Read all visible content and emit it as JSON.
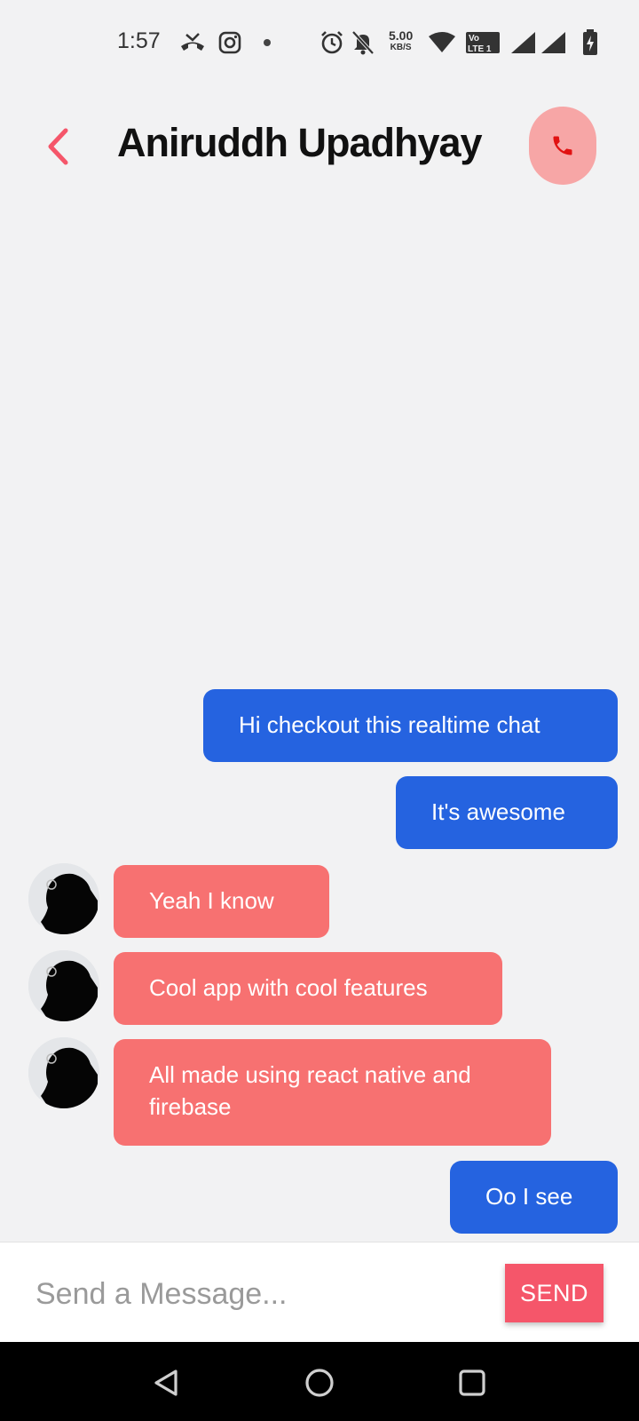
{
  "status_bar": {
    "time": "1:57",
    "speed_value": "5.00",
    "speed_unit": "KB/S",
    "icons": [
      "missed-call-icon",
      "instagram-icon",
      "dot-icon",
      "alarm-icon",
      "bell-off-icon",
      "wifi-icon",
      "volte-icon",
      "signal-icon",
      "signal-icon",
      "battery-charging-icon"
    ],
    "volte_label": "LTE 1"
  },
  "header": {
    "contact_name": "Aniruddh Upadhyay",
    "back_icon": "chevron-left-icon",
    "call_icon": "phone-icon"
  },
  "messages": [
    {
      "type": "sent",
      "text": "Hi checkout this realtime chat"
    },
    {
      "type": "sent",
      "text": "It's awesome"
    },
    {
      "type": "received",
      "text": "Yeah I know"
    },
    {
      "type": "received",
      "text": "Cool app with cool features"
    },
    {
      "type": "received",
      "text": "All made using react native and firebase"
    },
    {
      "type": "sent",
      "text": "Oo I see"
    }
  ],
  "composer": {
    "placeholder": "Send a Message...",
    "value": "",
    "send_label": "SEND"
  },
  "nav_bar": {
    "icons": [
      "back-triangle-icon",
      "home-circle-icon",
      "recents-square-icon"
    ]
  },
  "colors": {
    "accent": "#f5566a",
    "sent_bubble": "#2563e0",
    "received_bubble": "#f77171",
    "call_button_bg": "#f7a6a6",
    "background": "#f2f2f3"
  }
}
